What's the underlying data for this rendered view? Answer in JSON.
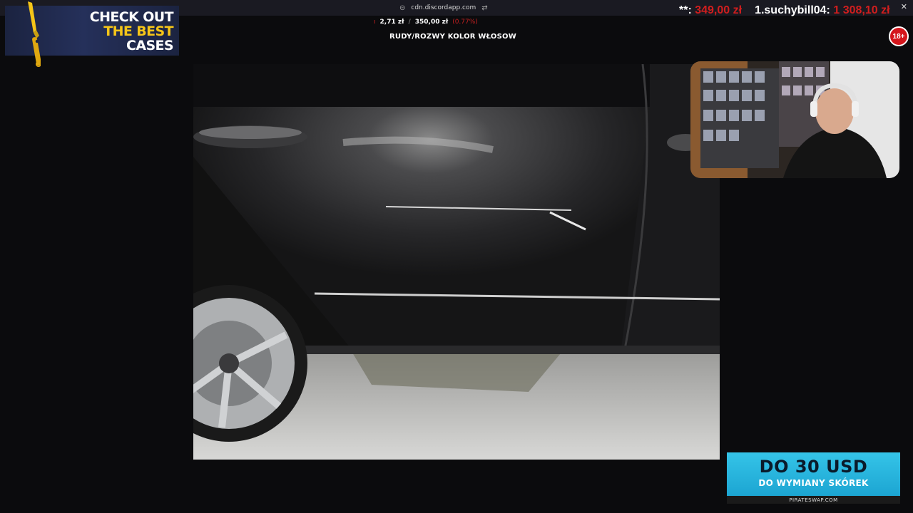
{
  "browser": {
    "url": "cdn.discordapp.com",
    "close_icon": "close-icon",
    "link_icon": "link-icon",
    "settings_icon": "sliders-icon"
  },
  "donation": {
    "amount": "2,71 zł",
    "separator": "/",
    "goal": "350,00 zł",
    "percent": "(0.77%)",
    "message": "RUDY/ROZWY KOLOR WŁOSOW"
  },
  "top_donor": {
    "masked_name": "**:",
    "masked_amount": "349,00 zł",
    "leader_name": "1.suchybill04:",
    "leader_amount": "1 308,10 zł"
  },
  "age_badge": "18+",
  "ad_cases": {
    "line1": "CHECK OUT",
    "line2": "THE BEST",
    "line3": "CASES",
    "accent_color": "#f5c518"
  },
  "ad_usd": {
    "headline": "DO 30 USD",
    "subline": "DO WYMIANY SKÓREK",
    "brand": "PIRATESWAP.COM",
    "accent_color": "#1ca5d2"
  },
  "colors": {
    "donation_red": "#d21e1e",
    "badge_red": "#d4161c"
  }
}
